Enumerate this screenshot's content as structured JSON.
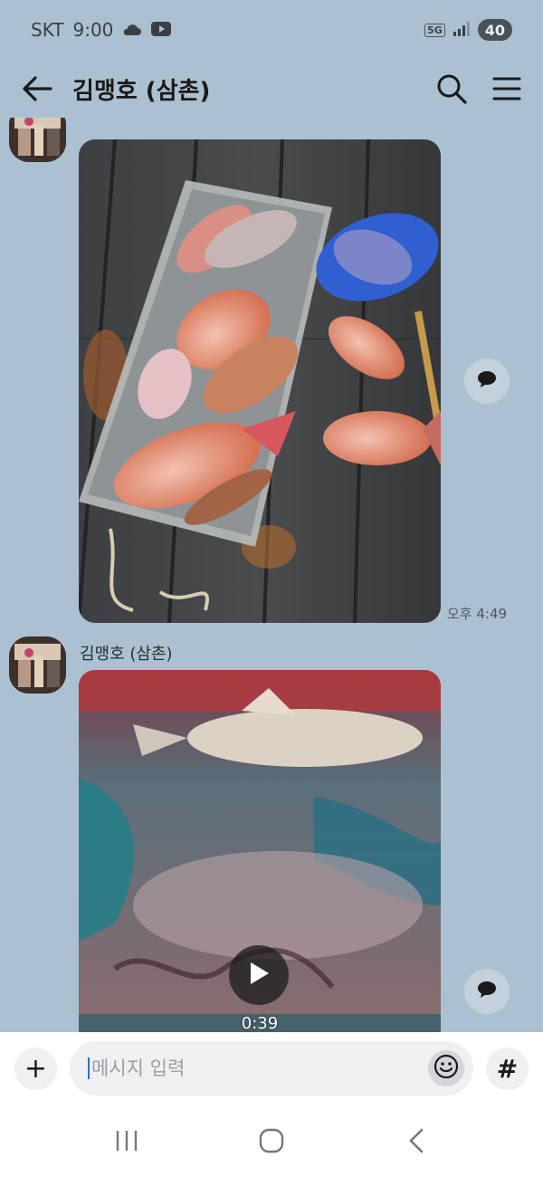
{
  "status_bar": {
    "carrier": "SKT",
    "time": "9:00",
    "network": "5G",
    "battery": "40"
  },
  "header": {
    "title": "김맹호 (삼촌)"
  },
  "messages": [
    {
      "type": "photo",
      "description_icon": "fish-catch-photo",
      "timestamp": "오후 4:49"
    },
    {
      "type": "video",
      "sender": "김맹호 (삼촌)",
      "duration": "0:39"
    }
  ],
  "input": {
    "placeholder": "메시지 입력",
    "add_label": "+",
    "hash_label": "#"
  },
  "colors": {
    "chat_background": "#abc1d1",
    "input_background": "#eef0f2",
    "accent_caret": "#2a6fdb"
  }
}
